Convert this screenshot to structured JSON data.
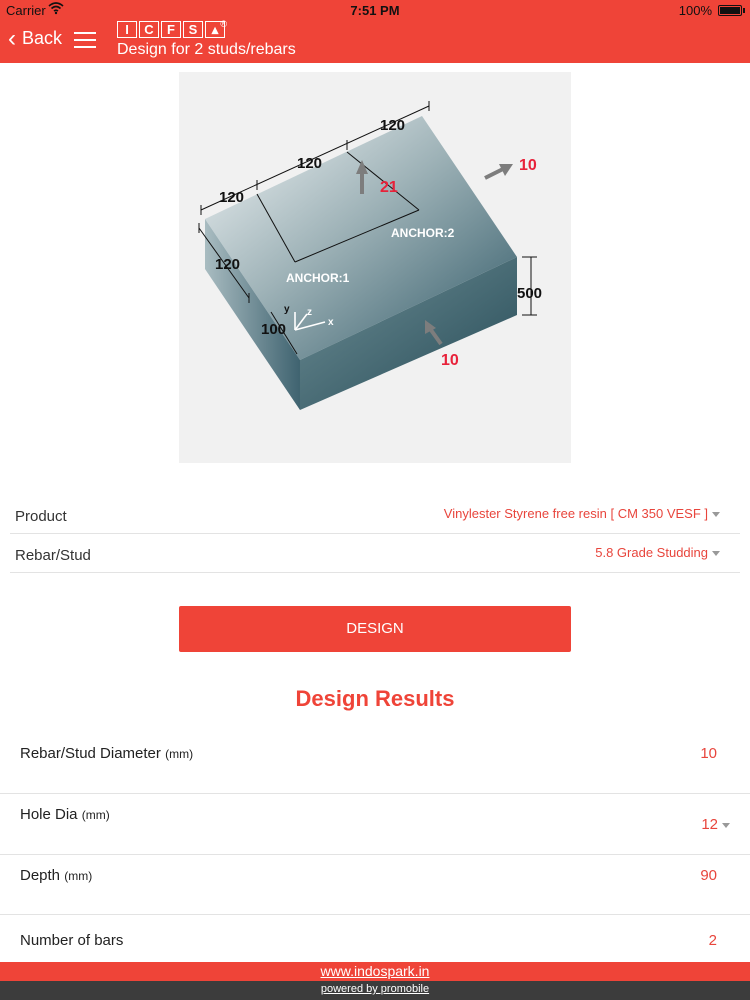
{
  "status": {
    "carrier": "Carrier",
    "time": "7:51 PM",
    "battery": "100%"
  },
  "nav": {
    "back_label": "Back",
    "logo_letters": [
      "I",
      "C",
      "F",
      "S"
    ],
    "logo_reg": "®",
    "title": "Design for 2 studs/rebars"
  },
  "diagram": {
    "dims": {
      "top_right": "120",
      "top_mid": "120",
      "top_left": "120",
      "left": "120",
      "corner": "100",
      "height": "500"
    },
    "anchors": [
      "ANCHOR:1",
      "ANCHOR:2"
    ],
    "loads": {
      "vertical": "21",
      "right": "10",
      "front": "10"
    },
    "axes": {
      "x": "x",
      "y": "y",
      "z": "z"
    },
    "colors": {
      "load": "#e8223a",
      "block_light": "#eef3f4",
      "block_dark": "#2a4f5b"
    }
  },
  "form": {
    "product_label": "Product",
    "product_value": "Vinylester Styrene free resin [ CM 350 VESF ]",
    "rebar_label": "Rebar/Stud",
    "rebar_value": "5.8 Grade Studding"
  },
  "design_button": "DESIGN",
  "results": {
    "title": "Design Results",
    "rows": [
      {
        "label": "Rebar/Stud Diameter",
        "unit": "(mm)",
        "value": "10"
      },
      {
        "label": "Hole Dia",
        "unit": "(mm)",
        "value": "12"
      },
      {
        "label": "Depth",
        "unit": "(mm)",
        "value": "90"
      },
      {
        "label": "Number of bars",
        "unit": "",
        "value": "2"
      }
    ]
  },
  "footer": {
    "site": "www.indospark.in",
    "powered": "powered by promobile"
  },
  "theme": {
    "accent": "#ef4438",
    "text_accent": "#e8453c",
    "footer_dark": "#3c3c3c"
  }
}
